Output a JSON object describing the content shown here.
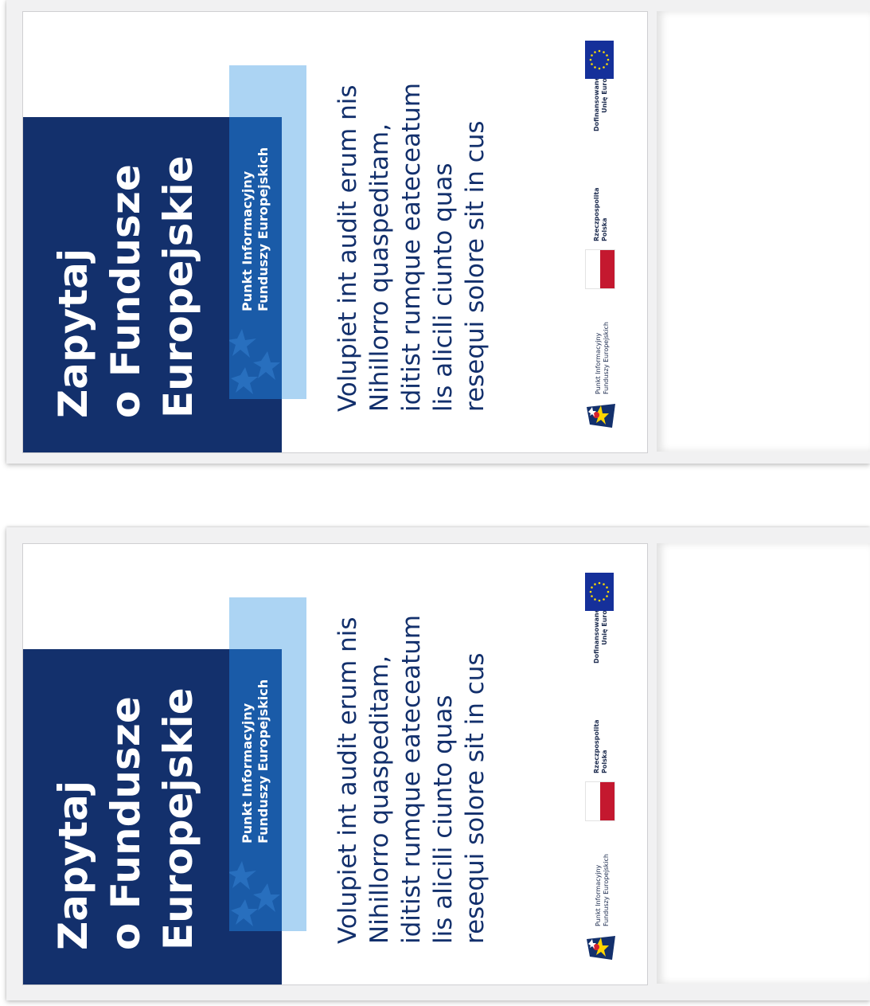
{
  "posters": [
    {
      "title_lines": [
        "Zapytaj",
        "o Fundusze",
        "Europejskie"
      ],
      "pif_lines": [
        "Punkt Informacyjny",
        "Funduszy Europejskich"
      ],
      "body_lines": [
        "Volupiet int audit erum nis",
        "Nihillorro quaspeditam,",
        "iditist rumque eateceatum",
        "lis alicili ciunto quas",
        "resequi solore sit in cus"
      ],
      "logo_pif": [
        "Punkt Informacyjny",
        "Funduszy Europejskich"
      ],
      "logo_pl": [
        "Rzeczpospolita",
        "Polska"
      ],
      "logo_eu": [
        "Dofinansowane przez",
        "Unię Europejską"
      ]
    },
    {
      "title_lines": [
        "Zapytaj",
        "o Fundusze",
        "Europejskie"
      ],
      "pif_lines": [
        "Punkt Informacyjny",
        "Funduszy Europejskich"
      ],
      "body_lines": [
        "Volupiet int audit erum nis",
        "Nihillorro quaspeditam,",
        "iditist rumque eateceatum",
        "lis alicili ciunto quas",
        "resequi solore sit in cus"
      ],
      "logo_pif": [
        "Punkt Informacyjny",
        "Funduszy Europejskich"
      ],
      "logo_pl": [
        "Rzeczpospolita",
        "Polska"
      ],
      "logo_eu": [
        "Dofinansowane przez",
        "Unię Europejską"
      ]
    }
  ],
  "colors": {
    "navy": "#13306c",
    "mid_blue": "#1a5ba8",
    "light_blue": "#acd4f3",
    "pl_red": "#c4182f",
    "eu_blue": "#15309a",
    "eu_star": "#ffde00"
  }
}
